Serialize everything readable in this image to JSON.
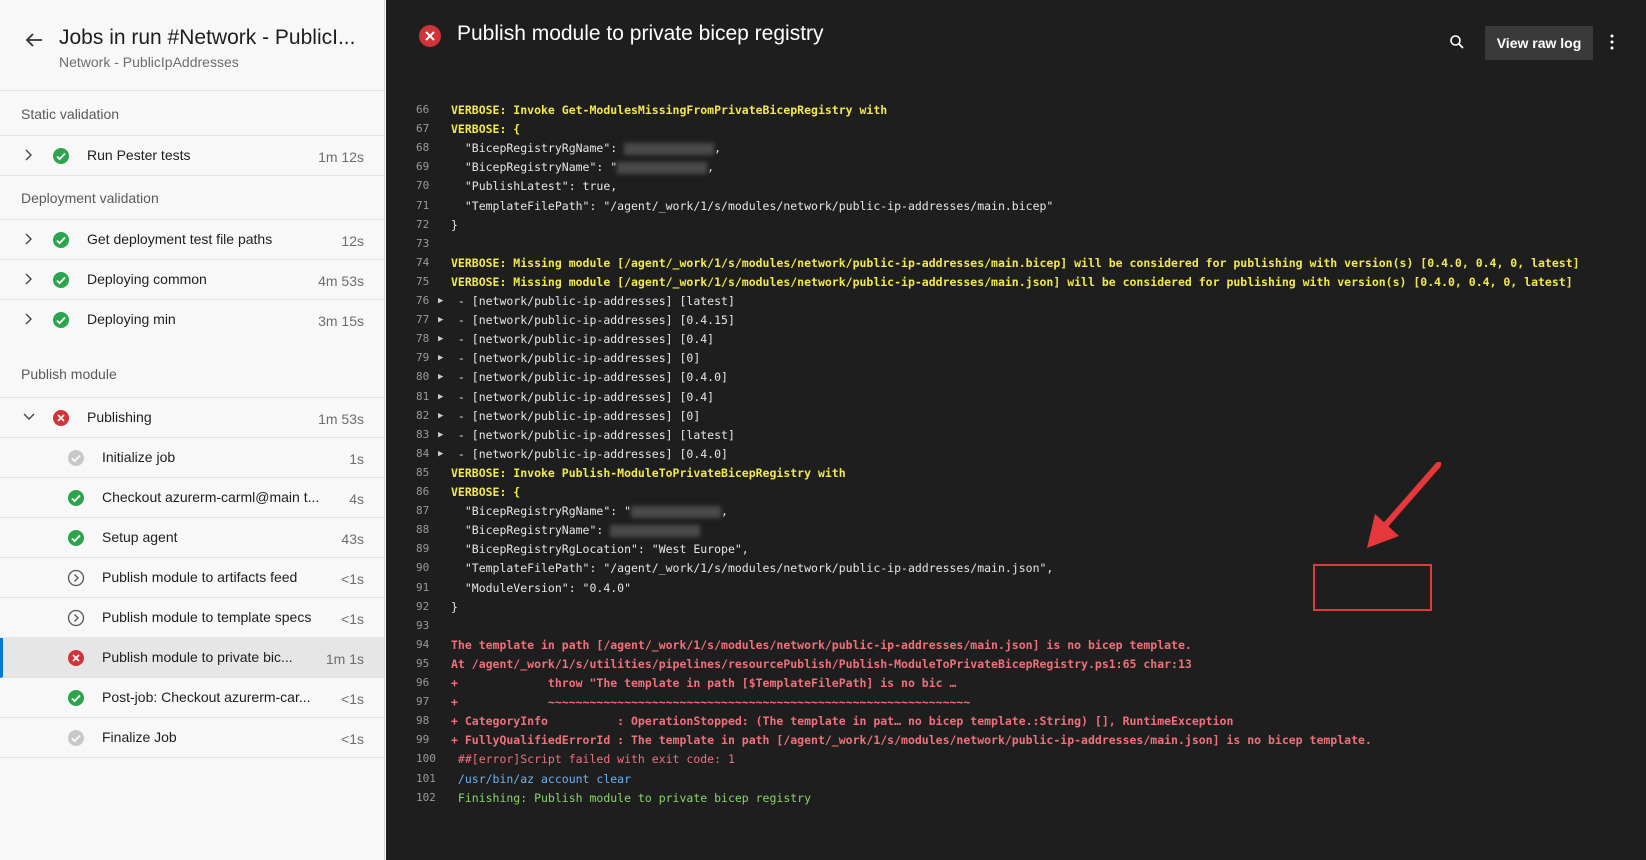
{
  "header": {
    "title": "Jobs in run #Network - PublicI...",
    "subtitle": "Network - PublicIpAddresses"
  },
  "sections": [
    {
      "label": "Static validation",
      "jobs": [
        {
          "name": "Run Pester tests",
          "duration": "1m 12s",
          "status": "success"
        }
      ]
    },
    {
      "label": "Deployment validation",
      "jobs": [
        {
          "name": "Get deployment test file paths",
          "duration": "12s",
          "status": "success"
        },
        {
          "name": "Deploying common",
          "duration": "4m 53s",
          "status": "success"
        },
        {
          "name": "Deploying min",
          "duration": "3m 15s",
          "status": "success"
        }
      ]
    },
    {
      "label": "Publish module",
      "jobs": [
        {
          "name": "Publishing",
          "duration": "1m 53s",
          "status": "failed"
        }
      ]
    }
  ],
  "steps": [
    {
      "name": "Initialize job",
      "duration": "1s",
      "status": "done"
    },
    {
      "name": "Checkout azurerm-carml@main t...",
      "duration": "4s",
      "status": "success"
    },
    {
      "name": "Setup agent",
      "duration": "43s",
      "status": "success"
    },
    {
      "name": "Publish module to artifacts feed",
      "duration": "<1s",
      "status": "skipped"
    },
    {
      "name": "Publish module to template specs",
      "duration": "<1s",
      "status": "skipped"
    },
    {
      "name": "Publish module to private bic...",
      "duration": "1m 1s",
      "status": "failed"
    },
    {
      "name": "Post-job: Checkout azurerm-car...",
      "duration": "<1s",
      "status": "success"
    },
    {
      "name": "Finalize Job",
      "duration": "<1s",
      "status": "done"
    }
  ],
  "log_header": {
    "title": "Publish module to private bicep registry",
    "raw_log_button": "View raw log"
  },
  "log": [
    {
      "n": "66",
      "t": "VERBOSE: Invoke Get-ModulesMissingFromPrivateBicepRegistry with",
      "k": "verbose"
    },
    {
      "n": "67",
      "t": "VERBOSE: {",
      "k": "verbose"
    },
    {
      "n": "68",
      "t": "  \"BicepRegistryRgName\": ",
      "k": "plain",
      "redact": ","
    },
    {
      "n": "69",
      "t": "  \"BicepRegistryName\": \"",
      "k": "plain",
      "redact": ","
    },
    {
      "n": "70",
      "t": "  \"PublishLatest\": true,",
      "k": "plain"
    },
    {
      "n": "71",
      "t": "  \"TemplateFilePath\": \"/agent/_work/1/s/modules/network/public-ip-addresses/main.bicep\"",
      "k": "plain"
    },
    {
      "n": "72",
      "t": "}",
      "k": "plain"
    },
    {
      "n": "73",
      "t": "",
      "k": "plain"
    },
    {
      "n": "74",
      "t": "VERBOSE: Missing module [/agent/_work/1/s/modules/network/public-ip-addresses/main.bicep] will be considered for publishing with version(s) [0.4.0, 0.4, 0, latest]",
      "k": "verbose"
    },
    {
      "n": "75",
      "t": "VERBOSE: Missing module [/agent/_work/1/s/modules/network/public-ip-addresses/main.json] will be considered for publishing with version(s) [0.4.0, 0.4, 0, latest]",
      "k": "verbose"
    },
    {
      "n": "76",
      "t": " - [network/public-ip-addresses] [latest]",
      "k": "plain",
      "tri": true
    },
    {
      "n": "77",
      "t": " - [network/public-ip-addresses] [0.4.15]",
      "k": "plain",
      "tri": true
    },
    {
      "n": "78",
      "t": " - [network/public-ip-addresses] [0.4]",
      "k": "plain",
      "tri": true
    },
    {
      "n": "79",
      "t": " - [network/public-ip-addresses] [0]",
      "k": "plain",
      "tri": true
    },
    {
      "n": "80",
      "t": " - [network/public-ip-addresses] [0.4.0]",
      "k": "plain",
      "tri": true
    },
    {
      "n": "81",
      "t": " - [network/public-ip-addresses] [0.4]",
      "k": "plain",
      "tri": true
    },
    {
      "n": "82",
      "t": " - [network/public-ip-addresses] [0]",
      "k": "plain",
      "tri": true
    },
    {
      "n": "83",
      "t": " - [network/public-ip-addresses] [latest]",
      "k": "plain",
      "tri": true
    },
    {
      "n": "84",
      "t": " - [network/public-ip-addresses] [0.4.0]",
      "k": "plain",
      "tri": true
    },
    {
      "n": "85",
      "t": "VERBOSE: Invoke Publish-ModuleToPrivateBicepRegistry with",
      "k": "verbose"
    },
    {
      "n": "86",
      "t": "VERBOSE: {",
      "k": "verbose"
    },
    {
      "n": "87",
      "t": "  \"BicepRegistryRgName\": \"",
      "k": "plain",
      "redact": ","
    },
    {
      "n": "88",
      "t": "  \"BicepRegistryName\": ",
      "k": "plain",
      "redact": ""
    },
    {
      "n": "89",
      "t": "  \"BicepRegistryRgLocation\": \"West Europe\",",
      "k": "plain"
    },
    {
      "n": "90",
      "t": "  \"TemplateFilePath\": \"/agent/_work/1/s/modules/network/public-ip-addresses/main.json\",",
      "k": "plain"
    },
    {
      "n": "91",
      "t": "  \"ModuleVersion\": \"0.4.0\"",
      "k": "plain"
    },
    {
      "n": "92",
      "t": "}",
      "k": "plain"
    },
    {
      "n": "93",
      "t": "",
      "k": "plain"
    },
    {
      "n": "94",
      "t": "The template in path [/agent/_work/1/s/modules/network/public-ip-addresses/main.json] is no bicep template.",
      "k": "errb"
    },
    {
      "n": "95",
      "t": "At /agent/_work/1/s/utilities/pipelines/resourcePublish/Publish-ModuleToPrivateBicepRegistry.ps1:65 char:13",
      "k": "errb"
    },
    {
      "n": "96",
      "t": "+             throw \"The template in path [$TemplateFilePath] is no bic …",
      "k": "errb"
    },
    {
      "n": "97",
      "t": "+             ~~~~~~~~~~~~~~~~~~~~~~~~~~~~~~~~~~~~~~~~~~~~~~~~~~~~~~~~~~~~~",
      "k": "errb"
    },
    {
      "n": "98",
      "t": "+ CategoryInfo          : OperationStopped: (The template in pat… no bicep template.:String) [], RuntimeException",
      "k": "errb"
    },
    {
      "n": "99",
      "t": "+ FullyQualifiedErrorId : The template in path [/agent/_work/1/s/modules/network/public-ip-addresses/main.json] is no bicep template.",
      "k": "errb"
    },
    {
      "n": "100",
      "t": " ##[error]Script failed with exit code: 1",
      "k": "err"
    },
    {
      "n": "101",
      "t": " /usr/bin/az account clear",
      "k": "cmd"
    },
    {
      "n": "102",
      "t": " Finishing: Publish module to private bicep registry",
      "k": "fin"
    }
  ],
  "colors": {
    "success": "#2da44e",
    "failed": "#d13438",
    "skipped_done": "#a0a0a0",
    "annotation": "#e5383b"
  }
}
